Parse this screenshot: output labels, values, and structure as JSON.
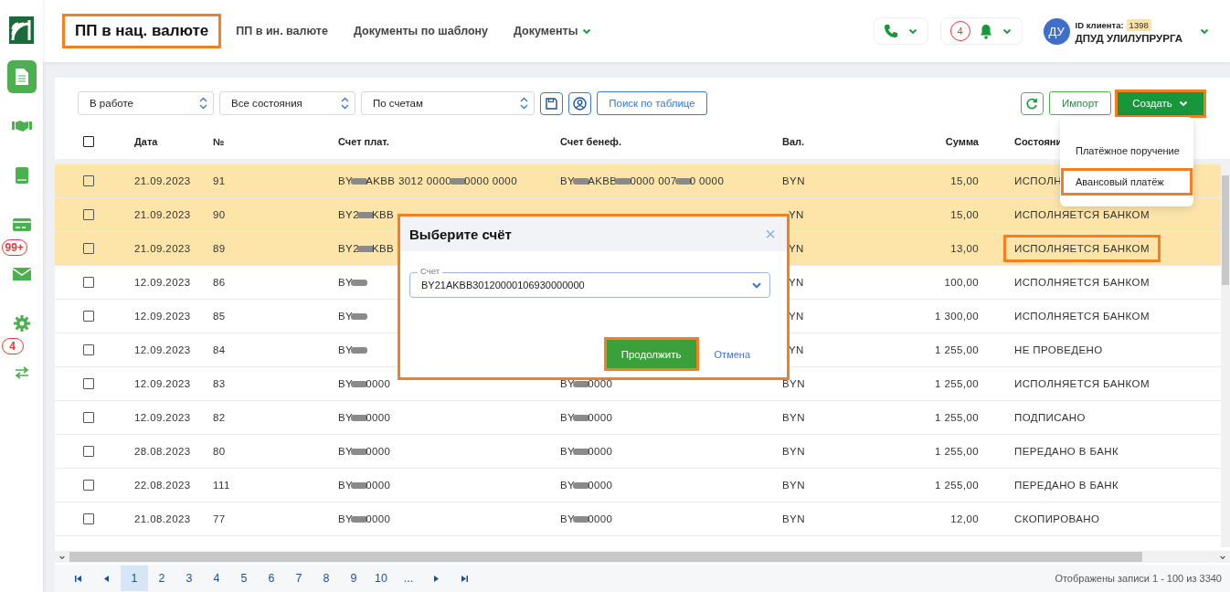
{
  "sidebar": {
    "items": [
      {
        "kind": "document",
        "selected": true
      },
      {
        "kind": "handshake",
        "selected": false
      },
      {
        "kind": "book",
        "selected": false
      },
      {
        "kind": "card",
        "selected": false
      },
      {
        "kind": "mail",
        "selected": false,
        "badge": "99+"
      },
      {
        "kind": "gear",
        "selected": false
      },
      {
        "kind": "transfer",
        "selected": false,
        "badge": "4"
      }
    ]
  },
  "nav": [
    {
      "label": "ПП в нац. валюте",
      "selected": true,
      "dropdown": false,
      "marked": true
    },
    {
      "label": "ПП в ин. валюте",
      "selected": false,
      "dropdown": false,
      "marked": false
    },
    {
      "label": "Документы по шаблону",
      "selected": false,
      "dropdown": false,
      "marked": false
    },
    {
      "label": "Документы",
      "selected": false,
      "dropdown": true,
      "marked": false
    }
  ],
  "header": {
    "notifications": "4",
    "avatar": "ДУ",
    "client_id_label": "ID клиента:",
    "client_id": "1398",
    "client_name": "ДПУД УЛИЛУПРУРГА"
  },
  "toolbar": {
    "selects": [
      "В работе",
      "Все состояния",
      "По счетам"
    ],
    "search_button": "Поиск по таблице",
    "import_button": "Импорт",
    "create_button": {
      "label": "Создать",
      "marked": true
    }
  },
  "create_menu": [
    {
      "label": "Платёжное поручение",
      "marked": false
    },
    {
      "label": "Авансовый платёж",
      "marked": true
    }
  ],
  "table": {
    "select_all_checked": false,
    "columns": [
      "Дата",
      "№",
      "Счет плат.",
      "Счет бенеф.",
      "Вал.",
      "Сумма",
      "Состояни"
    ],
    "rows": [
      {
        "checked": false,
        "highlighted": true,
        "date": "21.09.2023",
        "number": "91",
        "payer": [
          {
            "kind": "text",
            "text": "BY"
          },
          {
            "kind": "redacted"
          },
          {
            "kind": "text",
            "text": "AKBB 3012 0000"
          },
          {
            "kind": "redacted"
          },
          {
            "kind": "text",
            "text": "0000 0000"
          }
        ],
        "beneficiary": [
          {
            "kind": "text",
            "text": "BY"
          },
          {
            "kind": "redacted"
          },
          {
            "kind": "text",
            "text": "AKBB"
          },
          {
            "kind": "redacted"
          },
          {
            "kind": "text",
            "text": "0000 007"
          },
          {
            "kind": "redacted"
          },
          {
            "kind": "text",
            "text": "0 0000"
          }
        ],
        "currency": "BYN",
        "amount": "15,00",
        "status": "ИСПОЛН",
        "status_marked": false
      },
      {
        "checked": false,
        "highlighted": true,
        "date": "21.09.2023",
        "number": "90",
        "payer": [
          {
            "kind": "text",
            "text": "BY2"
          },
          {
            "kind": "redacted"
          },
          {
            "kind": "text",
            "text": "KBB"
          }
        ],
        "beneficiary": [],
        "currency": "YN",
        "amount": "15,00",
        "status": "ИСПОЛНЯЕТСЯ БАНКОМ",
        "status_marked": false
      },
      {
        "checked": false,
        "highlighted": true,
        "date": "21.09.2023",
        "number": "89",
        "payer": [
          {
            "kind": "text",
            "text": "BY2"
          },
          {
            "kind": "redacted"
          },
          {
            "kind": "text",
            "text": "KBB"
          }
        ],
        "beneficiary": [],
        "currency": "YN",
        "amount": "13,00",
        "status": "ИСПОЛНЯЕТСЯ БАНКОМ",
        "status_marked": true
      },
      {
        "checked": false,
        "highlighted": false,
        "date": "12.09.2023",
        "number": "86",
        "payer": [
          {
            "kind": "text",
            "text": "BY"
          },
          {
            "kind": "redacted"
          }
        ],
        "beneficiary": [],
        "currency": "YN",
        "amount": "100,00",
        "status": "ИСПОЛНЯЕТСЯ БАНКОМ",
        "status_marked": false
      },
      {
        "checked": false,
        "highlighted": false,
        "date": "12.09.2023",
        "number": "85",
        "payer": [
          {
            "kind": "text",
            "text": "BY"
          },
          {
            "kind": "redacted"
          }
        ],
        "beneficiary": [],
        "currency": "YN",
        "amount": "1 300,00",
        "status": "ИСПОЛНЯЕТСЯ БАНКОМ",
        "status_marked": false
      },
      {
        "checked": false,
        "highlighted": false,
        "date": "12.09.2023",
        "number": "84",
        "payer": [
          {
            "kind": "text",
            "text": "BY"
          },
          {
            "kind": "redacted"
          }
        ],
        "beneficiary": [],
        "currency": "YN",
        "amount": "1 255,00",
        "status": "НЕ ПРОВЕДЕНО",
        "status_marked": false
      },
      {
        "checked": false,
        "highlighted": false,
        "date": "12.09.2023",
        "number": "83",
        "payer": [
          {
            "kind": "text",
            "text": "BY"
          },
          {
            "kind": "redacted"
          },
          {
            "kind": "text",
            "text": "0000"
          }
        ],
        "beneficiary": [
          {
            "kind": "text",
            "text": "BY"
          },
          {
            "kind": "redacted"
          },
          {
            "kind": "text",
            "text": "0000"
          }
        ],
        "currency": "BYN",
        "amount": "1 255,00",
        "status": "ИСПОЛНЯЕТСЯ БАНКОМ",
        "status_marked": false
      },
      {
        "checked": false,
        "highlighted": false,
        "date": "12.09.2023",
        "number": "82",
        "payer": [
          {
            "kind": "text",
            "text": "BY"
          },
          {
            "kind": "redacted"
          },
          {
            "kind": "text",
            "text": "0000"
          }
        ],
        "beneficiary": [
          {
            "kind": "text",
            "text": "BY"
          },
          {
            "kind": "redacted"
          },
          {
            "kind": "text",
            "text": "0000"
          }
        ],
        "currency": "BYN",
        "amount": "1 255,00",
        "status": "ПОДПИСАНО",
        "status_marked": false
      },
      {
        "checked": false,
        "highlighted": false,
        "date": "28.08.2023",
        "number": "80",
        "payer": [
          {
            "kind": "text",
            "text": "BY"
          },
          {
            "kind": "redacted"
          },
          {
            "kind": "text",
            "text": "0000"
          }
        ],
        "beneficiary": [
          {
            "kind": "text",
            "text": "BY"
          },
          {
            "kind": "redacted"
          },
          {
            "kind": "text",
            "text": "0000"
          }
        ],
        "currency": "BYN",
        "amount": "1 255,00",
        "status": "ПЕРЕДАНО В БАНК",
        "status_marked": false
      },
      {
        "checked": false,
        "highlighted": false,
        "date": "22.08.2023",
        "number": "111",
        "payer": [
          {
            "kind": "text",
            "text": "BY"
          },
          {
            "kind": "redacted"
          },
          {
            "kind": "text",
            "text": "0000"
          }
        ],
        "beneficiary": [
          {
            "kind": "text",
            "text": "BY"
          },
          {
            "kind": "redacted"
          },
          {
            "kind": "text",
            "text": "0000"
          }
        ],
        "currency": "BYN",
        "amount": "1 255,00",
        "status": "ПЕРЕДАНО В БАНК",
        "status_marked": false
      },
      {
        "checked": false,
        "highlighted": false,
        "date": "21.08.2023",
        "number": "77",
        "payer": [
          {
            "kind": "text",
            "text": "BY"
          },
          {
            "kind": "redacted"
          },
          {
            "kind": "text",
            "text": "0000"
          }
        ],
        "beneficiary": [
          {
            "kind": "text",
            "text": "BY"
          },
          {
            "kind": "redacted"
          },
          {
            "kind": "text",
            "text": "0000"
          }
        ],
        "currency": "BYN",
        "amount": "12,00",
        "status": "СКОПИРОВАНО",
        "status_marked": false
      }
    ]
  },
  "pagination": {
    "pages": [
      {
        "label": "1",
        "selected": true
      },
      {
        "label": "2",
        "selected": false
      },
      {
        "label": "3",
        "selected": false
      },
      {
        "label": "4",
        "selected": false
      },
      {
        "label": "5",
        "selected": false
      },
      {
        "label": "6",
        "selected": false
      },
      {
        "label": "7",
        "selected": false
      },
      {
        "label": "8",
        "selected": false
      },
      {
        "label": "9",
        "selected": false
      },
      {
        "label": "10",
        "selected": false
      },
      {
        "label": "...",
        "selected": false
      }
    ],
    "summary": "Отображены записи 1 - 100 из 3340"
  },
  "dialog": {
    "title": "Выберите счёт",
    "close": "×",
    "field_label": "Счет",
    "field_value": "BY21AKBB30120000106930000000",
    "continue_button": "Продолжить",
    "cancel_link": "Отмена",
    "marked": true,
    "continue_marked": true
  }
}
